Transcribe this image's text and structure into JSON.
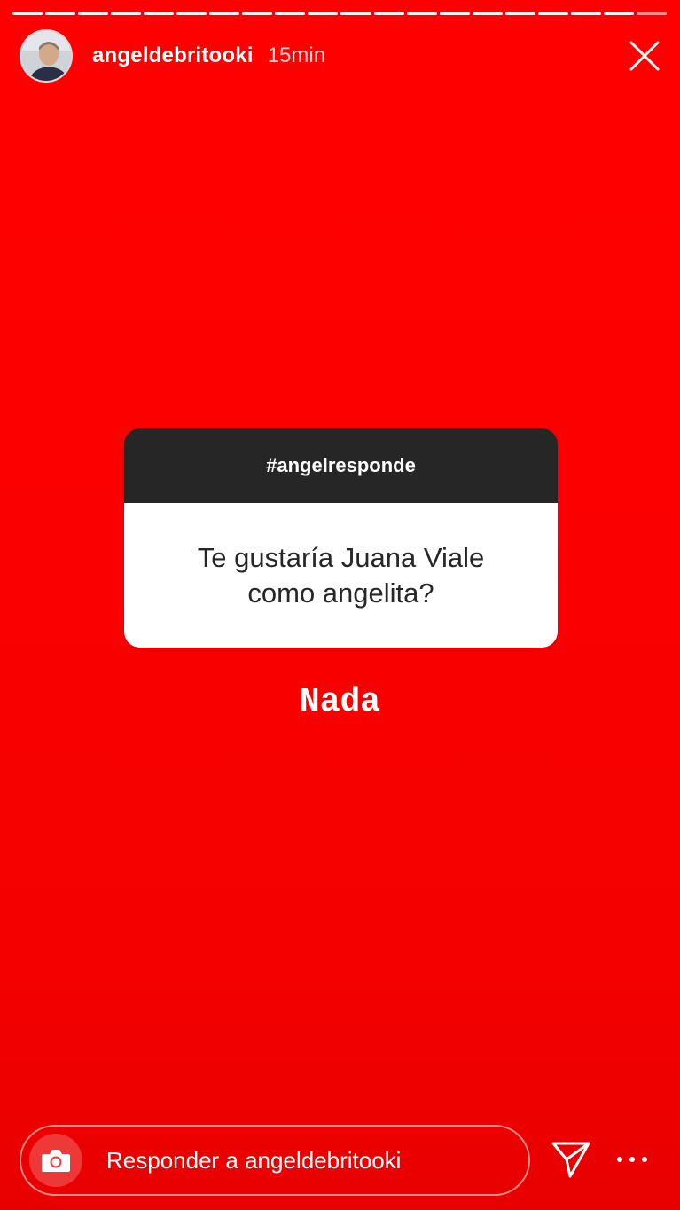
{
  "story": {
    "background_color": "#f40000",
    "segments_total": 20,
    "segments_done": 19
  },
  "header": {
    "username": "angeldebritooki",
    "time_ago": "15min",
    "avatar_icon": "profile-photo",
    "close_icon": "close-icon"
  },
  "question_sticker": {
    "hashtag": "#angelresponde",
    "question": "Te gustaría Juana Viale como angelita?",
    "header_color": "#262626",
    "body_color": "#ffffff"
  },
  "answer": {
    "text": "Nada"
  },
  "reply_bar": {
    "camera_icon": "camera-icon",
    "placeholder": "Responder a angeldebritooki",
    "send_icon": "paper-plane-icon",
    "more_icon": "more-dots-icon"
  }
}
